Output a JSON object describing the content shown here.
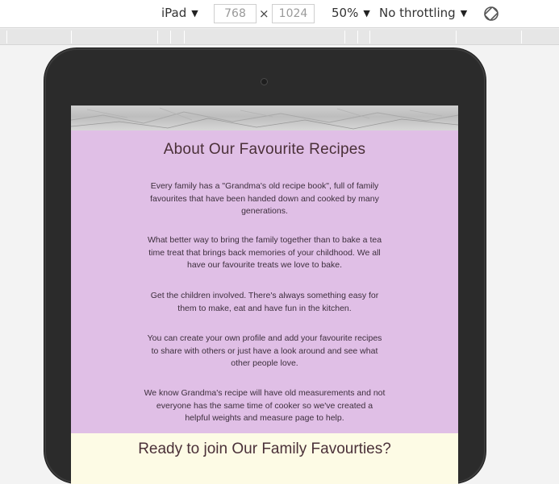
{
  "toolbar": {
    "device": "iPad",
    "width": "768",
    "height": "1024",
    "times": "×",
    "zoom": "50%",
    "throttling": "No throttling",
    "caret": "▼",
    "rotate_icon": "rotate-icon"
  },
  "page": {
    "about_title": "About Our Favourite Recipes",
    "paragraphs": [
      "Every family has a \"Grandma's old recipe book\", full of family favourites that have been handed down and cooked by many generations.",
      "What better way to bring the family together than to bake a tea time treat that brings back memories of your childhood. We all have our favourite treats we love to bake.",
      "Get the children involved. There's always something easy for them to make, eat and have fun in the kitchen.",
      "You can create your own profile and add your favourite recipes to share with others or just have a look around and see what other people love.",
      "We know Grandma's recipe will have old measurements and not everyone has the same time of cooker so we've created a helpful weights and measure page to help."
    ],
    "ready_title": "Ready to join Our Family Favourties?"
  },
  "colors": {
    "about_bg": "#e0bfe6",
    "ready_bg": "#fdfbe5",
    "device_frame": "#2b2b2b"
  }
}
